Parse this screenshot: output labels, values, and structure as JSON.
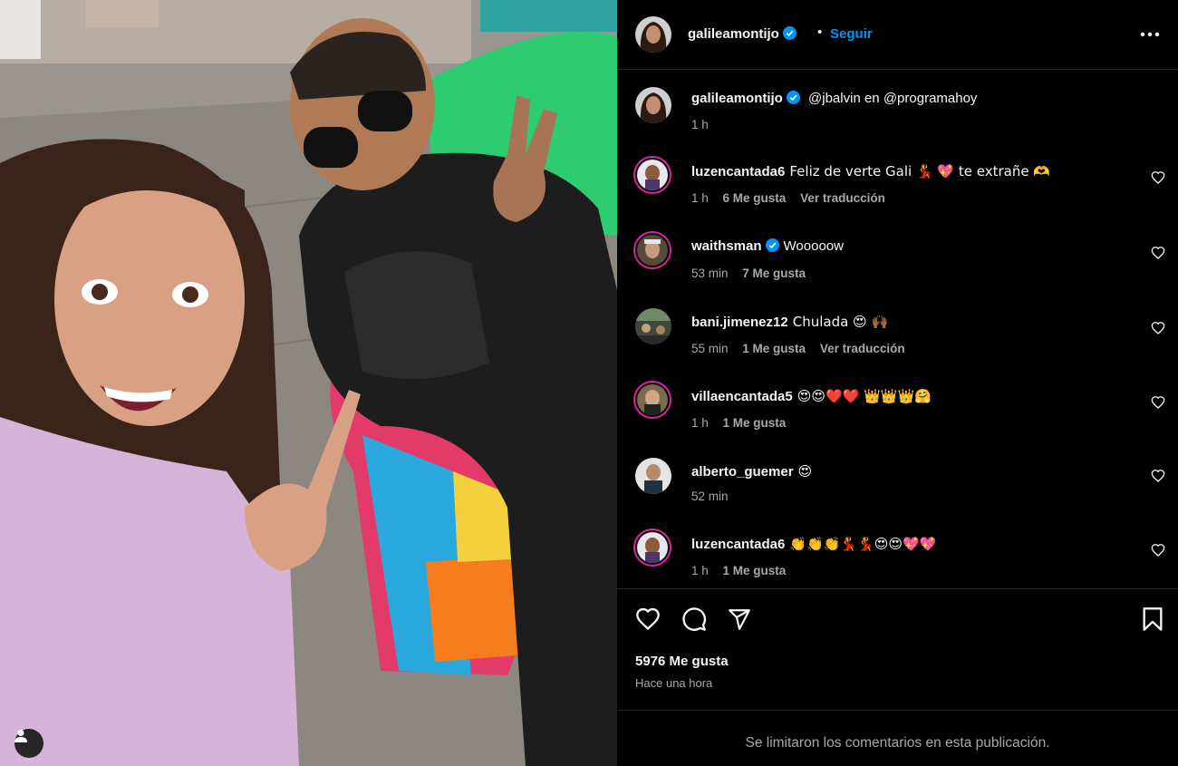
{
  "post": {
    "author": "galileamontijo",
    "follow_label": "Seguir",
    "separator": "•",
    "caption_mention_1": "@jbalvin",
    "caption_word": "en",
    "caption_mention_2": "@programahoy",
    "caption_time": "1 h",
    "likes": "5976 Me gusta",
    "posted": "Hace una hora",
    "comments_limited": "Se limitaron los comentarios en esta publicación."
  },
  "comments": [
    {
      "user": "luzencantada6",
      "verified": false,
      "text": "Feliz de verte Gali 💃 💖  te extrañe 🫶",
      "time": "1 h",
      "likes": "6 Me gusta",
      "translate": "Ver traducción"
    },
    {
      "user": "waithsman",
      "verified": true,
      "text": "Wooooow",
      "time": "53 min",
      "likes": "7 Me gusta",
      "translate": ""
    },
    {
      "user": "bani.jimenez12",
      "verified": false,
      "text": "Chulada 😍 🙌🏾",
      "time": "55 min",
      "likes": "1 Me gusta",
      "translate": "Ver traducción"
    },
    {
      "user": "villaencantada5",
      "verified": false,
      "text": "😍😍❤️❤️  👑👑👑🤗",
      "time": "1 h",
      "likes": "1 Me gusta",
      "translate": ""
    },
    {
      "user": "alberto_guemer",
      "verified": false,
      "text": "😍",
      "time": "52 min",
      "likes": "",
      "translate": ""
    },
    {
      "user": "luzencantada6",
      "verified": false,
      "text": "👏👏👏💃💃😍😍💖💖",
      "time": "1 h",
      "likes": "1 Me gusta",
      "translate": ""
    }
  ],
  "icons": {
    "verified": "verified-badge-icon",
    "more": "more-options-icon",
    "like": "heart-icon",
    "comment": "comment-icon",
    "share": "share-icon",
    "save": "bookmark-icon",
    "tag": "user-tag-icon"
  },
  "colors": {
    "accent": "#0095f6",
    "background": "#000000",
    "muted_text": "#a8a8a8",
    "divider": "#262626",
    "story_ring": "#d6249f"
  }
}
